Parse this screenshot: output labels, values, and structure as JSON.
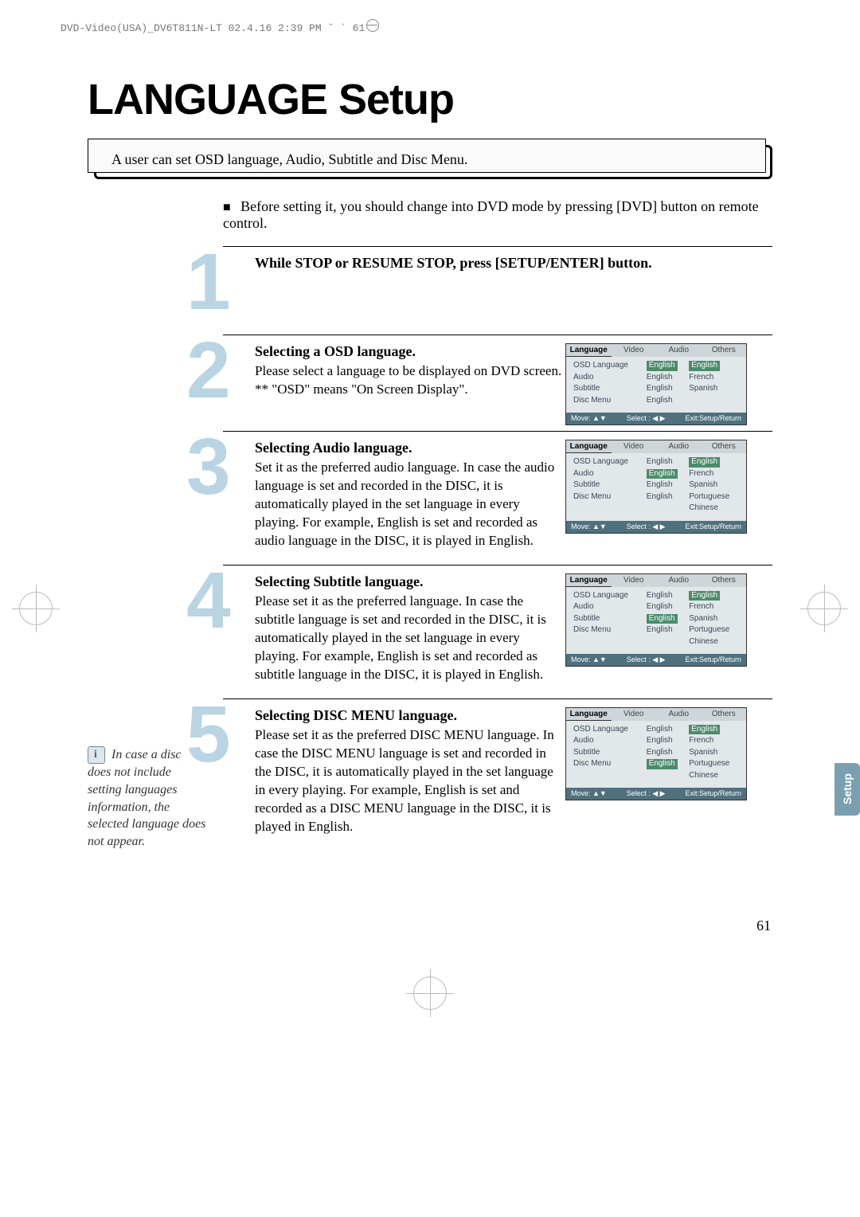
{
  "meta_header": "DVD-Video(USA)_DV6T811N-LT  02.4.16 2:39 PM  ˘ ` 61",
  "title": "LANGUAGE Setup",
  "intro": "A user can set OSD language, Audio, Subtitle and Disc Menu.",
  "prenote_bullet": "■",
  "prenote": "Before setting it, you should change into DVD mode by pressing [DVD] button on remote control.",
  "side_tab": "Setup",
  "page_number": "61",
  "note_text": "In case a disc does not include setting languages information, the selected language does not appear.",
  "osd_footer": {
    "move": "Move: ▲▼",
    "select": "Select : ◀ ▶",
    "exit": "Exit:Setup/Return"
  },
  "osd_tabs": [
    "Language",
    "Video",
    "Audio",
    "Others"
  ],
  "osd_rows": [
    "OSD Language",
    "Audio",
    "Subtitle",
    "Disc Menu"
  ],
  "steps": [
    {
      "num": "1",
      "heading": "While STOP or RESUME STOP, press [SETUP/ENTER] button.",
      "body": ""
    },
    {
      "num": "2",
      "heading": "Selecting a OSD language.",
      "body": "Please select a language to be displayed on DVD screen.\n** \"OSD\" means \"On Screen Display\"."
    },
    {
      "num": "3",
      "heading": "Selecting Audio language.",
      "body": "Set it as the preferred audio language. In case the audio language is set and recorded in the DISC, it is automatically played in the set language in every playing. For example, English is set and recorded as audio language in the DISC, it is played in English."
    },
    {
      "num": "4",
      "heading": "Selecting Subtitle language.",
      "body": "Please set it as the preferred language. In case the subtitle language is set and recorded in the DISC, it is automatically played in the set language in every playing. For example, English is set and recorded as subtitle language in the DISC, it is played in English."
    },
    {
      "num": "5",
      "heading": "Selecting DISC MENU language.",
      "body": "Please set it as the preferred DISC MENU language. In case the DISC MENU language is set and recorded in the DISC, it is automatically played in the set language in every playing. For example, English is set and recorded as a DISC MENU language in the DISC, it is played in English."
    }
  ],
  "osd_panels": {
    "p2": {
      "col2": [
        "English",
        "English",
        "English",
        "English"
      ],
      "col2_sel": [
        true,
        false,
        false,
        false
      ],
      "col3": [
        "English",
        "French",
        "Spanish",
        ""
      ],
      "col3_sel": [
        true,
        false,
        false,
        false
      ]
    },
    "p3": {
      "col2": [
        "English",
        "English",
        "English",
        "English"
      ],
      "col2_sel": [
        false,
        true,
        false,
        false
      ],
      "col3": [
        "English",
        "French",
        "Spanish",
        "Portuguese",
        "Chinese"
      ],
      "col3_sel": [
        true,
        false,
        false,
        false,
        false
      ]
    },
    "p4": {
      "col2": [
        "English",
        "English",
        "English",
        "English"
      ],
      "col2_sel": [
        false,
        false,
        true,
        false
      ],
      "col3": [
        "English",
        "French",
        "Spanish",
        "Portuguese",
        "Chinese"
      ],
      "col3_sel": [
        true,
        false,
        false,
        false,
        false
      ]
    },
    "p5": {
      "col2": [
        "English",
        "English",
        "English",
        "English"
      ],
      "col2_sel": [
        false,
        false,
        false,
        true
      ],
      "col3": [
        "English",
        "French",
        "Spanish",
        "Portuguese",
        "Chinese"
      ],
      "col3_sel": [
        true,
        false,
        false,
        false,
        false
      ]
    }
  }
}
